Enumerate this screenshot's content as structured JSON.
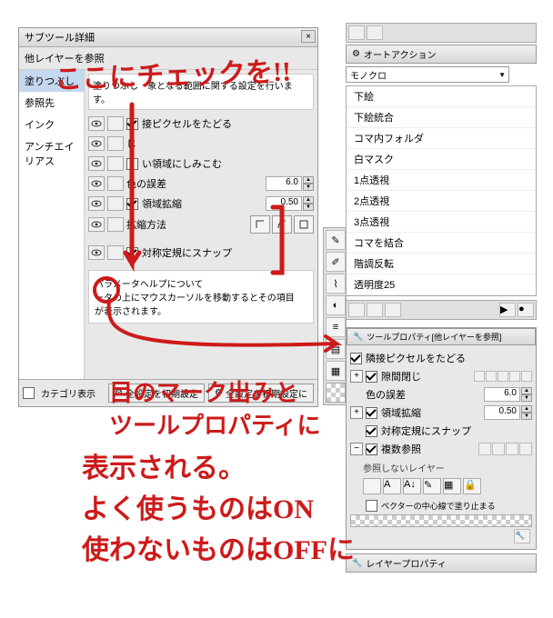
{
  "subtool": {
    "title": "サブツール詳細",
    "ref_title": "他レイヤーを参照",
    "categories": [
      "塗りつぶし",
      "参照先",
      "インク",
      "アンチエイリアス"
    ],
    "desc": "塗りつぶし　象となる範囲に関する設定を行います。",
    "rows": {
      "adjacent": "接ピクセルをたどる",
      "closegap": "じ",
      "closegap2": "い領域にしみこむ",
      "color_margin": "色の誤差",
      "color_margin_val": "6.0",
      "area_scale": "領域拡縮",
      "area_scale_val": "0.50",
      "scale_method": "拡縮方法",
      "snap": "対称定規にスナップ"
    },
    "help": {
      "title": "パラメータヘルプについて",
      "body": "ータの上にマウスカーソルを移動するとその項目　が表示されます。"
    },
    "footer": {
      "cat": "カテゴリ表示",
      "reset_all": "全設定を初期設定",
      "reset_all2": "全設定を初期設定に"
    }
  },
  "right": {
    "autoaction": "オートアクション",
    "dropdown": "モノクロ",
    "actions": [
      "下絵",
      "下絵統合",
      "コマ内フォルダ",
      "白マスク",
      "1点透視",
      "2点透視",
      "3点透視",
      "コマを結合",
      "階調反転",
      "透明度25"
    ],
    "toolprop_title": "ツールプロパティ[他レイヤーを参照]",
    "tp": {
      "adjacent": "隣接ピクセルをたどる",
      "closegap": "隙間閉じ",
      "color_margin": "色の誤差",
      "color_margin_val": "6.0",
      "area_scale": "領域拡縮",
      "area_scale_val": "0.50",
      "snap": "対称定規にスナップ",
      "multi_ref": "複数参照",
      "no_ref_layer": "参照しないレイヤー",
      "bottom": "ベクターの中心線で塗り止まる"
    },
    "layerprop": "レイヤープロパティ"
  },
  "annotations": {
    "top": "ここにチェックを!!",
    "body1": "目のマーク出みと",
    "body2": "ツールプロパティに",
    "body3": "表示される。",
    "body4": "よく使うものはON",
    "body5": "使わないものはOFFに"
  }
}
